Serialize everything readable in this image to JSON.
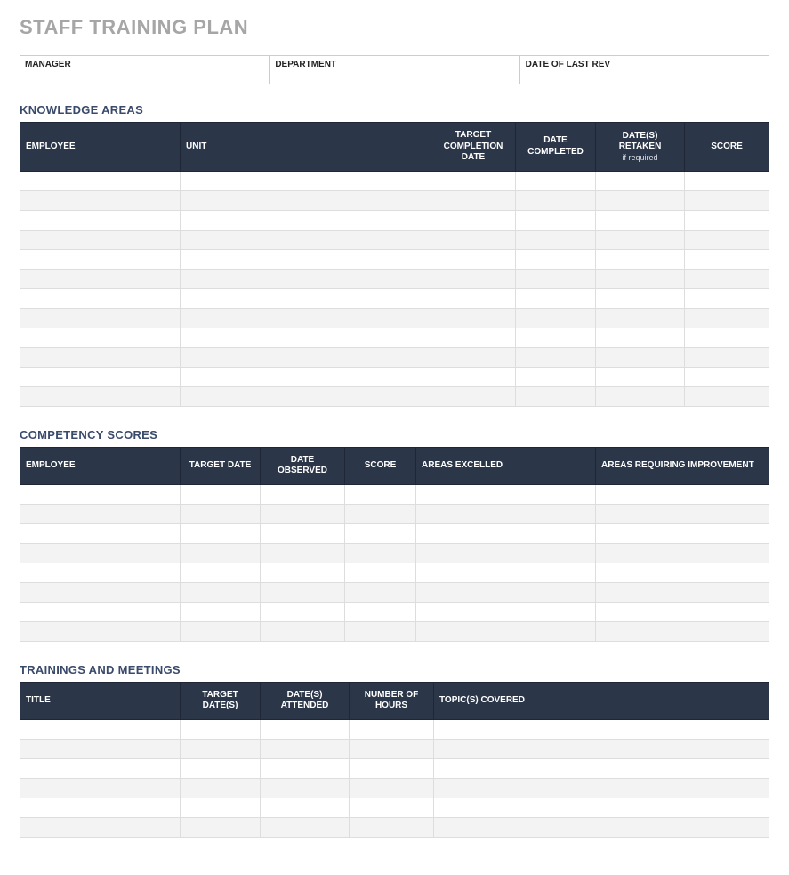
{
  "title": "STAFF TRAINING PLAN",
  "meta": {
    "manager_label": "MANAGER",
    "department_label": "DEPARTMENT",
    "last_rev_label": "DATE OF LAST REV"
  },
  "sections": {
    "knowledge": {
      "title": "KNOWLEDGE AREAS",
      "headers": {
        "employee": "EMPLOYEE",
        "unit": "UNIT",
        "target_completion": "TARGET COMPLETION DATE",
        "date_completed": "DATE COMPLETED",
        "dates_retaken": "DATE(S) RETAKEN",
        "dates_retaken_sub": "if required",
        "score": "SCORE"
      },
      "row_count": 12
    },
    "competency": {
      "title": "COMPETENCY SCORES",
      "headers": {
        "employee": "EMPLOYEE",
        "target_date": "TARGET DATE",
        "date_observed": "DATE OBSERVED",
        "score": "SCORE",
        "areas_excelled": "AREAS EXCELLED",
        "areas_improvement": "AREAS REQUIRING IMPROVEMENT"
      },
      "row_count": 8
    },
    "trainings": {
      "title": "TRAININGS AND MEETINGS",
      "headers": {
        "title": "TITLE",
        "target_dates": "TARGET DATE(S)",
        "dates_attended": "DATE(S) ATTENDED",
        "number_hours": "NUMBER OF HOURS",
        "topics_covered": "TOPIC(S) COVERED"
      },
      "row_count": 6
    }
  }
}
